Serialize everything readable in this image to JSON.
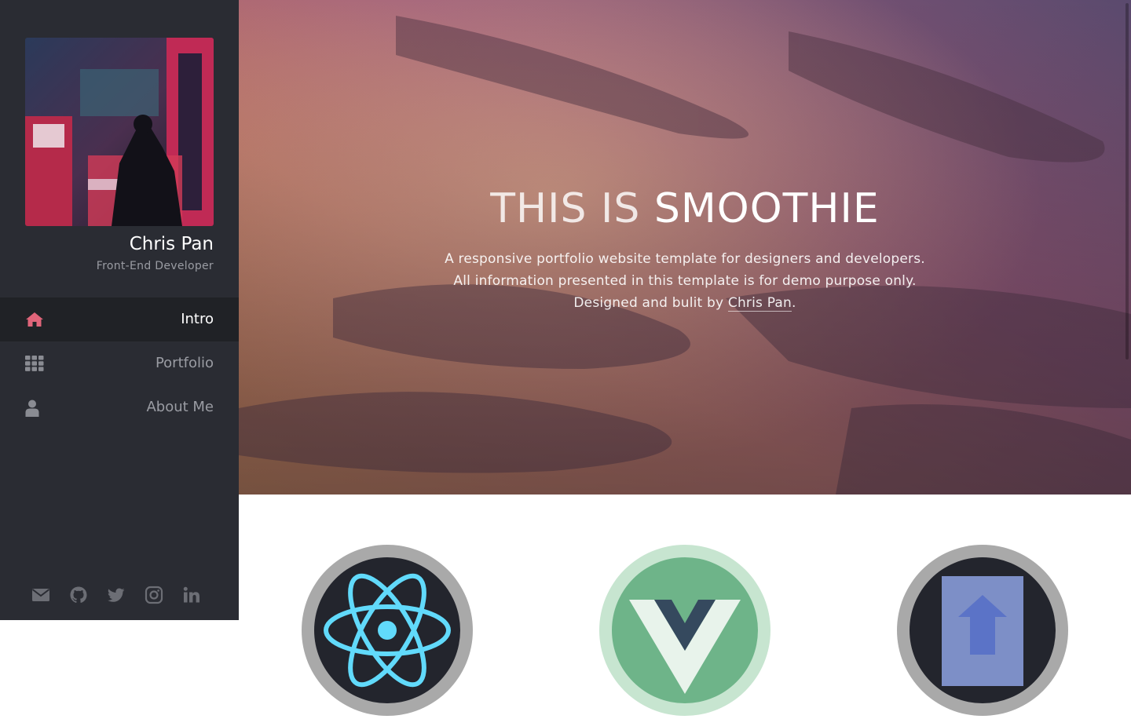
{
  "profile": {
    "name": "Chris Pan",
    "role": "Front-End Developer",
    "avatar": "cyberpunk-artwork-avatar"
  },
  "nav": {
    "items": [
      {
        "label": "Intro",
        "icon": "home-icon",
        "active": true
      },
      {
        "label": "Portfolio",
        "icon": "grid-icon",
        "active": false
      },
      {
        "label": "About Me",
        "icon": "user-icon",
        "active": false
      }
    ]
  },
  "socials": [
    "email-icon",
    "github-icon",
    "twitter-icon",
    "instagram-icon",
    "linkedin-icon"
  ],
  "hero": {
    "title_light": "THIS IS",
    "title_bold": "SMOOTHIE",
    "line1": "A responsive portfolio website template for designers and developers.",
    "line2": "All information presented in this template is for demo purpose only.",
    "line3_prefix": "Designed and bulit by",
    "line3_link": "Chris Pan",
    "line3_suffix": "."
  },
  "skills": [
    "react-logo",
    "vue-logo",
    "storybook-logo"
  ],
  "colors": {
    "sidebar_bg": "#2a2c33",
    "active_bg": "#202226",
    "accent": "#e0657a",
    "muted_text": "#9a9ca3"
  }
}
